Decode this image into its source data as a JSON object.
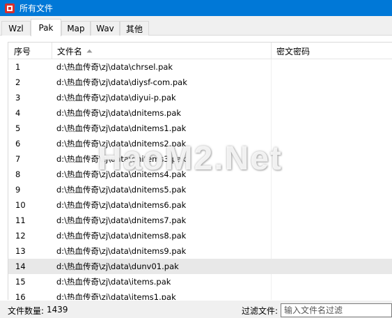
{
  "window": {
    "title": "所有文件",
    "icon": "app-icon",
    "accent_color": "#0078d7"
  },
  "tabs": [
    {
      "label": "Wzl",
      "active": false
    },
    {
      "label": "Pak",
      "active": true
    },
    {
      "label": "Map",
      "active": false
    },
    {
      "label": "Wav",
      "active": false
    },
    {
      "label": "其他",
      "active": false
    }
  ],
  "table": {
    "columns": [
      "序号",
      "文件名",
      "密文密码"
    ],
    "sort_icon": "sort-ascending-icon",
    "rows": [
      {
        "index": "1",
        "file": "d:\\热血传奇\\zj\\data\\chrsel.pak"
      },
      {
        "index": "2",
        "file": "d:\\热血传奇\\zj\\data\\diysf-com.pak"
      },
      {
        "index": "3",
        "file": "d:\\热血传奇\\zj\\data\\diyui-p.pak"
      },
      {
        "index": "4",
        "file": "d:\\热血传奇\\zj\\data\\dnitems.pak"
      },
      {
        "index": "5",
        "file": "d:\\热血传奇\\zj\\data\\dnitems1.pak"
      },
      {
        "index": "6",
        "file": "d:\\热血传奇\\zj\\data\\dnitems2.pak"
      },
      {
        "index": "7",
        "file": "d:\\热血传奇\\zj\\data\\dnitems3.pak"
      },
      {
        "index": "8",
        "file": "d:\\热血传奇\\zj\\data\\dnitems4.pak"
      },
      {
        "index": "9",
        "file": "d:\\热血传奇\\zj\\data\\dnitems5.pak"
      },
      {
        "index": "10",
        "file": "d:\\热血传奇\\zj\\data\\dnitems6.pak"
      },
      {
        "index": "11",
        "file": "d:\\热血传奇\\zj\\data\\dnitems7.pak"
      },
      {
        "index": "12",
        "file": "d:\\热血传奇\\zj\\data\\dnitems8.pak"
      },
      {
        "index": "13",
        "file": "d:\\热血传奇\\zj\\data\\dnitems9.pak"
      },
      {
        "index": "14",
        "file": "d:\\热血传奇\\zj\\data\\dunv01.pak",
        "selected": true
      },
      {
        "index": "15",
        "file": "d:\\热血传奇\\zj\\data\\items.pak"
      },
      {
        "index": "16",
        "file": "d:\\热血传奇\\zj\\data\\items1.pak"
      }
    ]
  },
  "status": {
    "count_label": "文件数量:",
    "count_value": "1439",
    "filter_label": "过滤文件:",
    "filter_placeholder": "输入文件名过滤",
    "filter_value": ""
  },
  "watermark": "HaoM2.Net"
}
